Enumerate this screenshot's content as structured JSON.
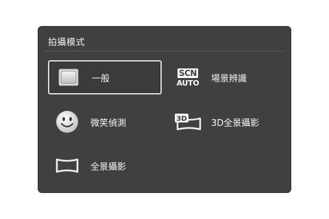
{
  "dialog": {
    "title": "拍攝模式"
  },
  "options": [
    {
      "label": "一般",
      "icon": "normal-mode-icon",
      "selected": true
    },
    {
      "label": "場景辨識",
      "icon": "scn-auto-icon",
      "icon_text_top": "SCN",
      "icon_text_bottom": "AUTO",
      "selected": false
    },
    {
      "label": "微笑偵測",
      "icon": "smile-icon",
      "selected": false
    },
    {
      "label": "3D全景攝影",
      "icon": "3d-panorama-icon",
      "icon_text": "3D",
      "selected": false
    },
    {
      "label": "全景攝影",
      "icon": "panorama-icon",
      "selected": false
    }
  ],
  "colors": {
    "panel": "#404040",
    "text": "#f5f5f5",
    "selected_border": "#dcdcdc"
  }
}
